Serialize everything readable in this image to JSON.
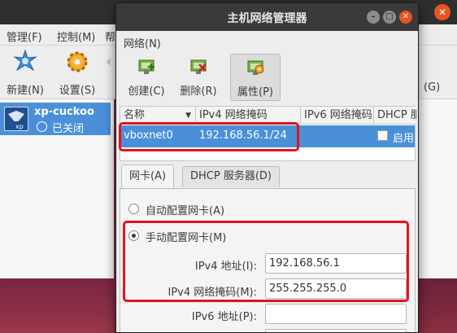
{
  "main": {
    "menu": [
      "管理(F)",
      "控制(M)",
      "帮"
    ],
    "toolbar": {
      "new": "新建(N)",
      "settings": "设置(S)",
      "right_partial": "(G)"
    },
    "vm": {
      "name": "xp-cuckoo",
      "state": "已关闭"
    }
  },
  "dialog": {
    "title": "主机网络管理器",
    "menu": "网络(N)",
    "toolbar": {
      "create": "创建(C)",
      "remove": "删除(R)",
      "properties": "属性(P)"
    },
    "table": {
      "headers": [
        "名称",
        "IPv4 网络掩码",
        "IPv6 网络掩码",
        "DHCP 服"
      ],
      "rows": [
        {
          "name": "vboxnet0",
          "ipv4": "192.168.56.1/24",
          "dhcp": "启用"
        }
      ]
    },
    "tabs": [
      "网卡(A)",
      "DHCP 服务器(D)"
    ],
    "adapter": {
      "auto_label": "自动配置网卡(A)",
      "manual_label": "手动配置网卡(M)",
      "ipv4_addr_label": "IPv4 地址(I):",
      "ipv4_addr_value": "192.168.56.1",
      "ipv4_mask_label": "IPv4 网络掩码(M):",
      "ipv4_mask_value": "255.255.255.0",
      "ipv6_addr_label": "IPv6 地址(P):",
      "ipv6_addr_value": ""
    }
  },
  "colors": {
    "accent": "#4a90d9",
    "highlight": "#e8101a",
    "close": "#e95420"
  }
}
